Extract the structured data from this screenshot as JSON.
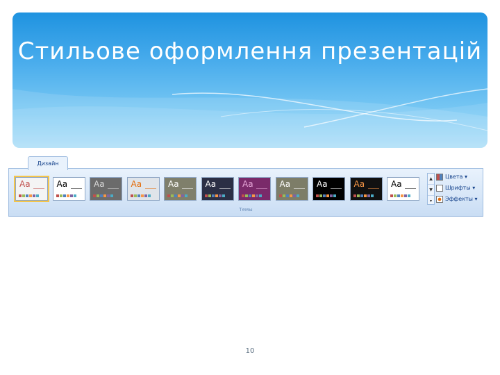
{
  "slide": {
    "title": "Стильове оформлення презентацій",
    "page_number": "10"
  },
  "ribbon": {
    "tab_label": "Дизайн",
    "group_label": "Темы",
    "options": {
      "colors": "Цвета",
      "fonts": "Шрифты",
      "effects": "Эффекты"
    },
    "themes": [
      {
        "label": "Aa",
        "bg": "#f4f4f4",
        "fg": "#c0504d",
        "selected": true
      },
      {
        "label": "Aa",
        "bg": "#ffffff",
        "fg": "#000000"
      },
      {
        "label": "Aa",
        "bg": "#6b6b6b",
        "fg": "#d9d9d9"
      },
      {
        "label": "Aa",
        "bg": "#dfe4ea",
        "fg": "#e46c0a"
      },
      {
        "label": "Aa",
        "bg": "#7f7f6b",
        "fg": "#ffffff"
      },
      {
        "label": "Aa",
        "bg": "#2b2f45",
        "fg": "#ffffff"
      },
      {
        "label": "Aa",
        "bg": "#7a2a6a",
        "fg": "#e6a6d8"
      },
      {
        "label": "Aa",
        "bg": "#7d7d68",
        "fg": "#ffffff"
      },
      {
        "label": "Aa",
        "bg": "#000000",
        "fg": "#ffffff"
      },
      {
        "label": "Aa",
        "bg": "#111111",
        "fg": "#f79646"
      },
      {
        "label": "Aa",
        "bg": "#ffffff",
        "fg": "#000000"
      }
    ]
  }
}
